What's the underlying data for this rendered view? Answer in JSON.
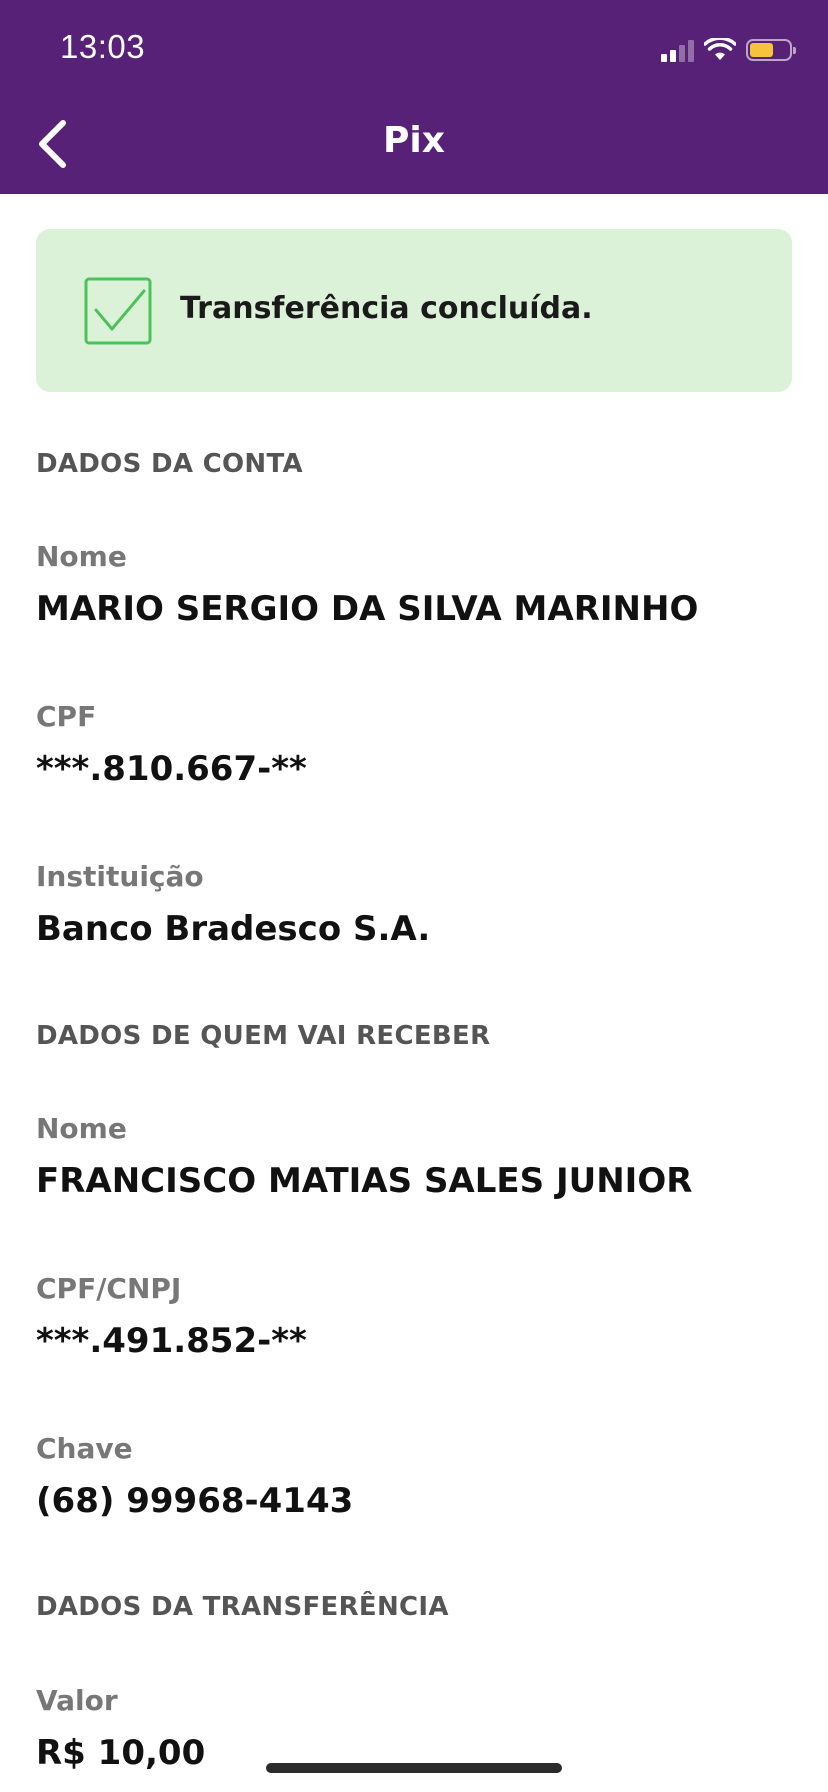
{
  "status_bar": {
    "time": "13:03"
  },
  "nav": {
    "title": "Pix",
    "back_icon": "chevron-left-icon"
  },
  "banner": {
    "message": "Transferência concluída.",
    "icon": "check-square-icon",
    "background": "#dcf2d8",
    "icon_color": "#4cc35a"
  },
  "colors": {
    "header": "#562176"
  },
  "account_section": {
    "title": "DADOS DA CONTA",
    "name_label": "Nome",
    "name_value": "MARIO SERGIO DA SILVA MARINHO",
    "cpf_label": "CPF",
    "cpf_value": "***.810.667-**",
    "institution_label": "Instituição",
    "institution_value": "Banco Bradesco S.A."
  },
  "receiver_section": {
    "title": "DADOS DE QUEM VAI RECEBER",
    "name_label": "Nome",
    "name_value": "FRANCISCO MATIAS SALES JUNIOR",
    "doc_label": "CPF/CNPJ",
    "doc_value": "***.491.852-**",
    "key_label": "Chave",
    "key_value": "(68) 99968-4143"
  },
  "transfer_section": {
    "title": "DADOS DA TRANSFERÊNCIA",
    "amount_label": "Valor",
    "amount_value": "R$ 10,00"
  }
}
